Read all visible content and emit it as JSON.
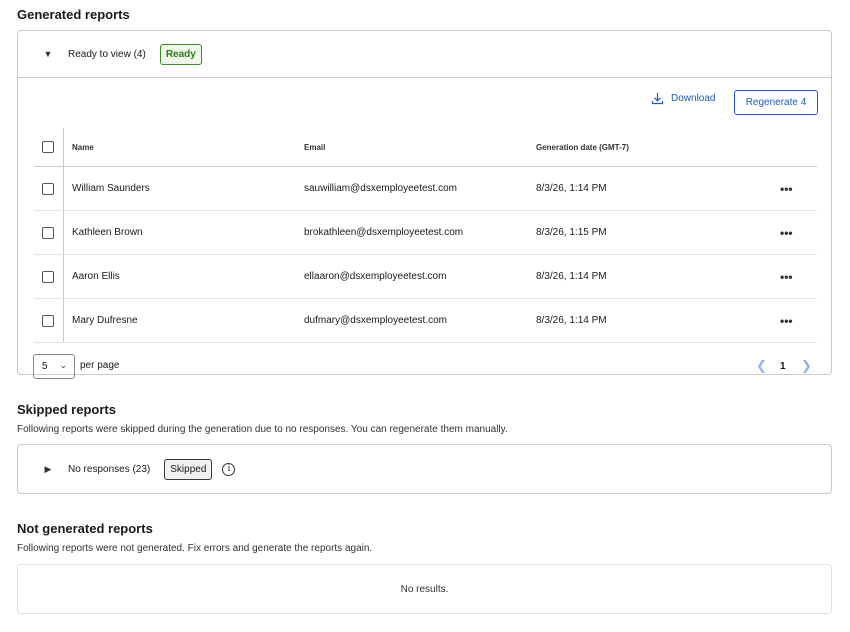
{
  "generated": {
    "title": "Generated reports",
    "accordion_label": "Ready to view (4)",
    "badge": "Ready",
    "download_label": "Download",
    "regenerate_label": "Regenerate 4",
    "columns": {
      "name": "Name",
      "email": "Email",
      "date": "Generation date (GMT-7)"
    },
    "rows": [
      {
        "name": "William Saunders",
        "email": "sauwilliam@dsxemployeetest.com",
        "date": "8/3/26, 1:14 PM"
      },
      {
        "name": "Kathleen Brown",
        "email": "brokathleen@dsxemployeetest.com",
        "date": "8/3/26, 1:15 PM"
      },
      {
        "name": "Aaron Ellis",
        "email": "ellaaron@dsxemployeetest.com",
        "date": "8/3/26, 1:14 PM"
      },
      {
        "name": "Mary Dufresne",
        "email": "dufmary@dsxemployeetest.com",
        "date": "8/3/26, 1:14 PM"
      }
    ],
    "more_glyph": "•••",
    "per_page_value": "5",
    "per_page_label": "per page",
    "page_number": "1"
  },
  "skipped": {
    "title": "Skipped reports",
    "description": "Following reports were skipped during the generation due to no responses. You can regenerate them manually.",
    "accordion_label": "No responses (23)",
    "badge": "Skipped",
    "info_glyph": "i"
  },
  "not_generated": {
    "title": "Not generated reports",
    "description": "Following reports were not generated. Fix errors and generate the reports again.",
    "empty_text": "No results."
  },
  "colors": {
    "accent": "#1e5bc6",
    "ready": "#2f7a1f",
    "border": "#c9c9c9"
  }
}
